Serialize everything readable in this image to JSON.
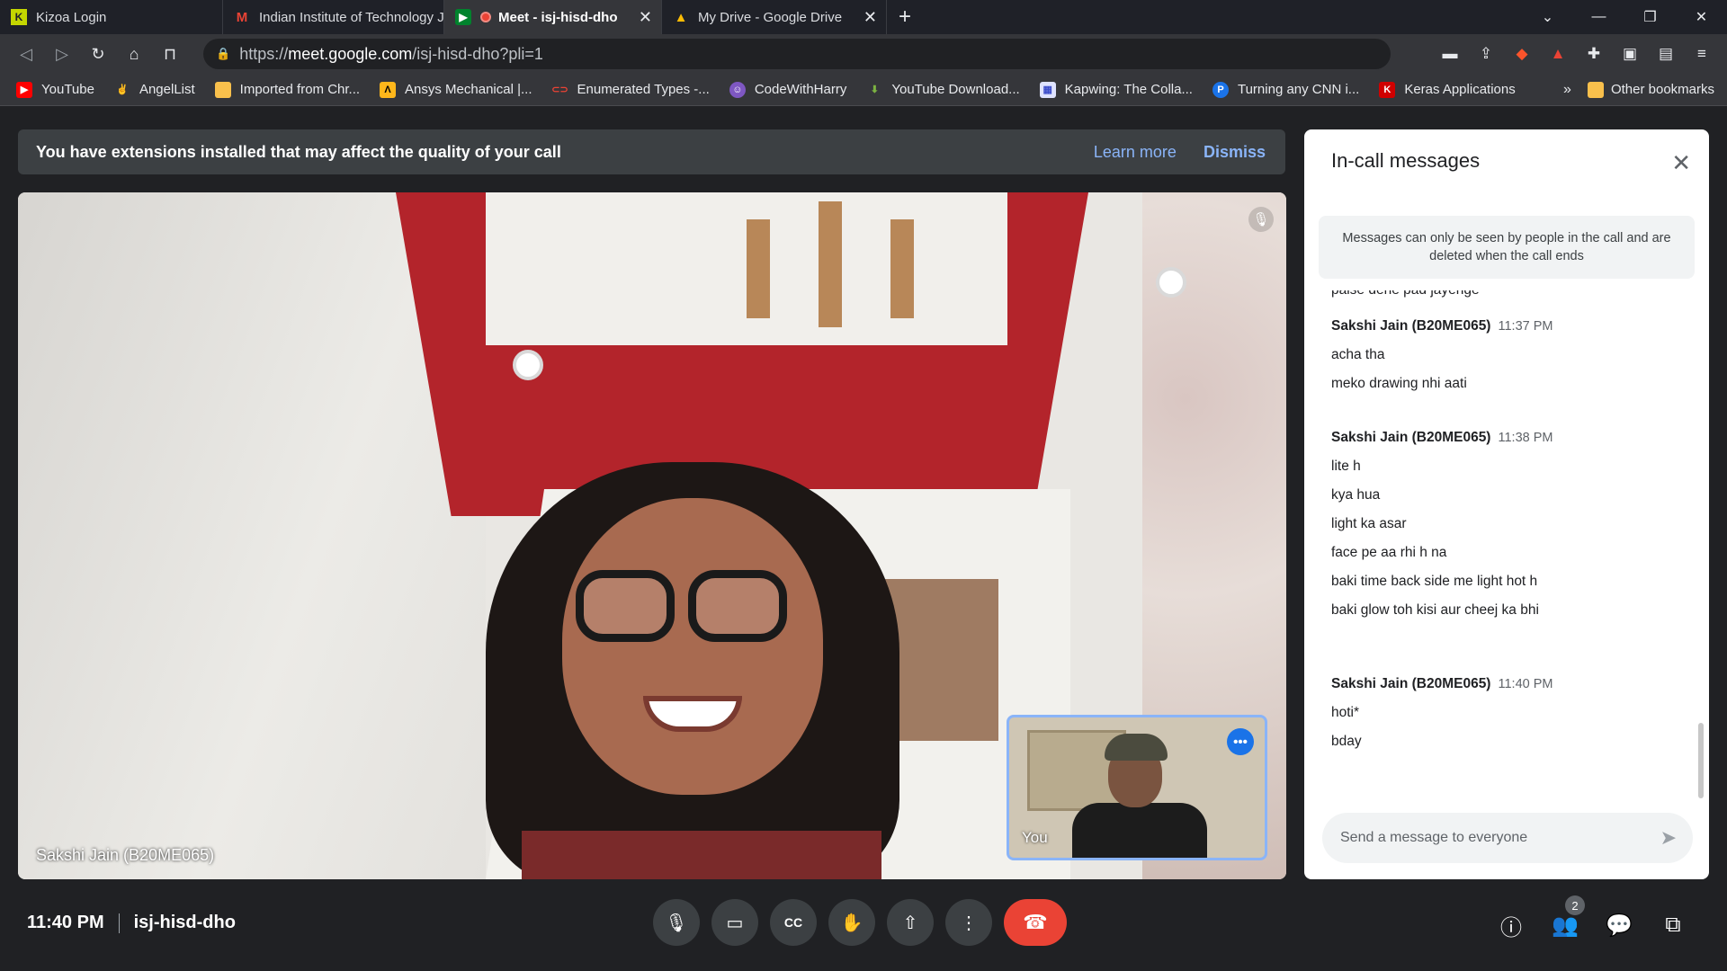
{
  "tabs": [
    {
      "title": "Kizoa Login",
      "icon": "kizoa-icon",
      "active": false
    },
    {
      "title": "Indian Institute of Technology Jodhpur",
      "icon": "gmail-icon",
      "active": false
    },
    {
      "title": "Meet - isj-hisd-dho",
      "icon": "meet-icon",
      "active": true
    },
    {
      "title": "My Drive - Google Drive",
      "icon": "drive-icon",
      "active": false
    }
  ],
  "url": {
    "prefix": "https://",
    "host": "meet.google.com",
    "path": "/isj-hisd-dho?pli=1"
  },
  "bookmarks": [
    "YouTube",
    "AngelList",
    "Imported from Chr...",
    "Ansys Mechanical |...",
    "Enumerated Types -...",
    "CodeWithHarry",
    "YouTube Download...",
    "Kapwing: The Colla...",
    "Turning any CNN i...",
    "Keras Applications"
  ],
  "bookmarks_more": "»",
  "other_bookmarks": "Other bookmarks",
  "banner": {
    "text": "You have extensions installed that may affect the quality of your call",
    "learn_more": "Learn more",
    "dismiss": "Dismiss"
  },
  "main_participant": "Sakshi Jain (B20ME065)",
  "self_label": "You",
  "panel": {
    "title": "In-call messages",
    "notice": "Messages can only be seen by people in the call and are deleted when the call ends",
    "cut_message": "paise dene pad jayenge",
    "groups": [
      {
        "sender": "Sakshi Jain (B20ME065)",
        "time": "11:37 PM",
        "messages": [
          "acha tha",
          "meko drawing nhi aati"
        ]
      },
      {
        "sender": "Sakshi Jain (B20ME065)",
        "time": "11:38 PM",
        "messages": [
          "lite h",
          "kya hua",
          "light ka asar",
          "face pe aa rhi h na",
          "baki time back side me light hot h",
          "baki glow toh kisi aur cheej ka bhi"
        ]
      },
      {
        "sender": "Sakshi Jain (B20ME065)",
        "time": "11:40 PM",
        "messages": [
          "hoti*",
          "bday"
        ]
      }
    ],
    "input_placeholder": "Send a message to everyone"
  },
  "footer": {
    "time": "11:40 PM",
    "meeting_code": "isj-hisd-dho",
    "participants_count": "2"
  },
  "colors": {
    "accent": "#8ab4f8",
    "end_call": "#ea4335",
    "self_border": "#8ab4f8"
  }
}
